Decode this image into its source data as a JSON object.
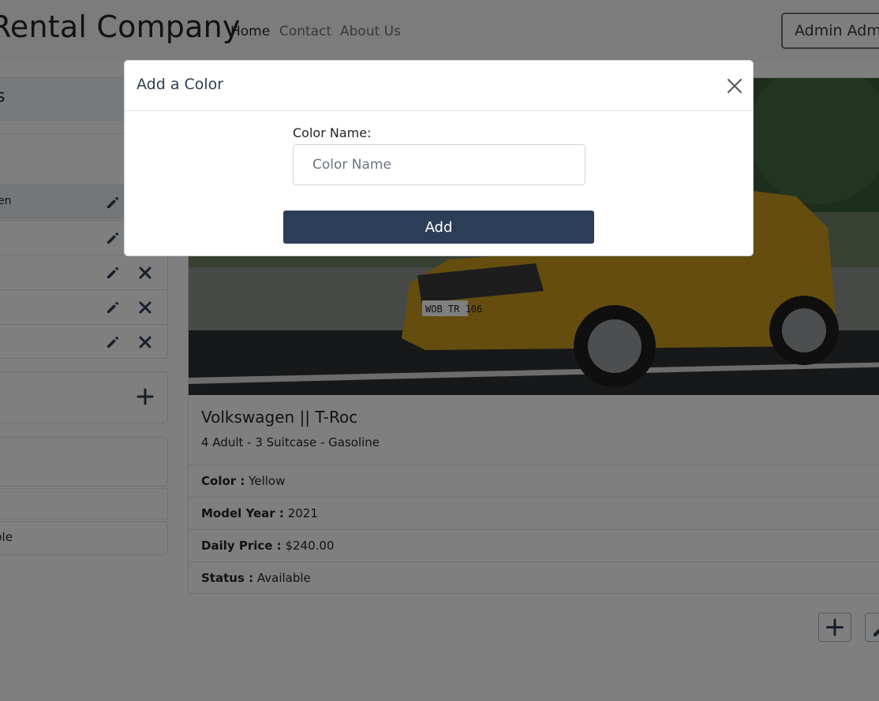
{
  "navbar": {
    "brand": "Rental Company",
    "links": [
      "Home",
      "Contact",
      "About Us"
    ],
    "admin_button": "Admin Admin"
  },
  "sidebar": {
    "header": "s",
    "brands": [
      {
        "label": "en",
        "active": true,
        "deletable": false
      },
      {
        "label": "",
        "active": false,
        "deletable": false
      },
      {
        "label": "",
        "active": false,
        "deletable": true
      },
      {
        "label": "",
        "active": false,
        "deletable": true
      },
      {
        "label": "",
        "active": false,
        "deletable": true
      }
    ],
    "status_filter": "ble"
  },
  "car": {
    "title": "Volkswagen || T-Roc",
    "subtitle": "4 Adult - 3 Suitcase - Gasoline",
    "plate": "WOB TR 106",
    "specs": [
      {
        "label": "Color :",
        "value": "Yellow"
      },
      {
        "label": "Model Year :",
        "value": "2021"
      },
      {
        "label": "Daily Price :",
        "value": "$240.00"
      },
      {
        "label": "Status :",
        "value": "Available"
      }
    ]
  },
  "modal": {
    "title": "Add a Color",
    "field_label": "Color Name:",
    "field_placeholder": "Color Name",
    "field_value": "",
    "submit_label": "Add"
  },
  "colors": {
    "primary": "#2c3e57",
    "car_body": "#c99a1e",
    "backdrop": "rgba(0,0,0,0.5)"
  }
}
